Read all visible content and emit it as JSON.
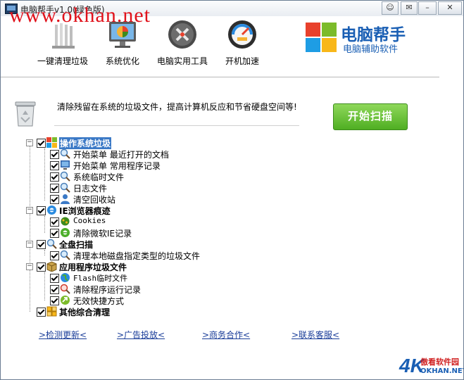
{
  "window": {
    "title": "电脑帮手v1.0(绿色版)",
    "watermark": "www.okhan.net",
    "controls": {
      "feedback": "☺",
      "skin": "✉",
      "minimize": "–",
      "close": "✕"
    }
  },
  "toolbar": [
    {
      "label": "一键清理垃圾",
      "icon": "broom-icon"
    },
    {
      "label": "系统优化",
      "icon": "monitor-icon"
    },
    {
      "label": "电脑实用工具",
      "icon": "tools-icon"
    },
    {
      "label": "开机加速",
      "icon": "speedometer-icon"
    }
  ],
  "brand": {
    "title": "电脑帮手",
    "subtitle": "电脑辅助软件",
    "colors": [
      "#e8412c",
      "#7cbb2a",
      "#1e9de4",
      "#f8b719"
    ]
  },
  "description": "清除残留在系统的垃圾文件，提高计算机反应和节省硬盘空间等!",
  "scan_button": "开始扫描",
  "tree": {
    "groups": [
      {
        "label": "操作系统垃圾",
        "selected": true,
        "children": [
          "开始菜单 最近打开的文档",
          "开始菜单 常用程序记录",
          "系统临时文件",
          "日志文件",
          "清空回收站"
        ]
      },
      {
        "label": "IE浏览器痕迹",
        "selected": false,
        "children": [
          "Cookies",
          "清除微软IE记录"
        ]
      },
      {
        "label": "全盘扫描",
        "selected": false,
        "children": [
          "清理本地磁盘指定类型的垃圾文件"
        ]
      },
      {
        "label": "应用程序垃圾文件",
        "selected": false,
        "children": [
          "Flash临时文件",
          "清除程序运行记录",
          "无效快捷方式"
        ]
      },
      {
        "label": "其他综合清理",
        "selected": false,
        "children": []
      }
    ],
    "expander_glyph": "−"
  },
  "footer_links": [
    ">检测更新<",
    ">广告投放<",
    ">商务合作<",
    ">联系客服<"
  ],
  "corner_watermark": {
    "mark": "4K",
    "text": "傲看软件园",
    "url": "OKHAN.NET"
  }
}
